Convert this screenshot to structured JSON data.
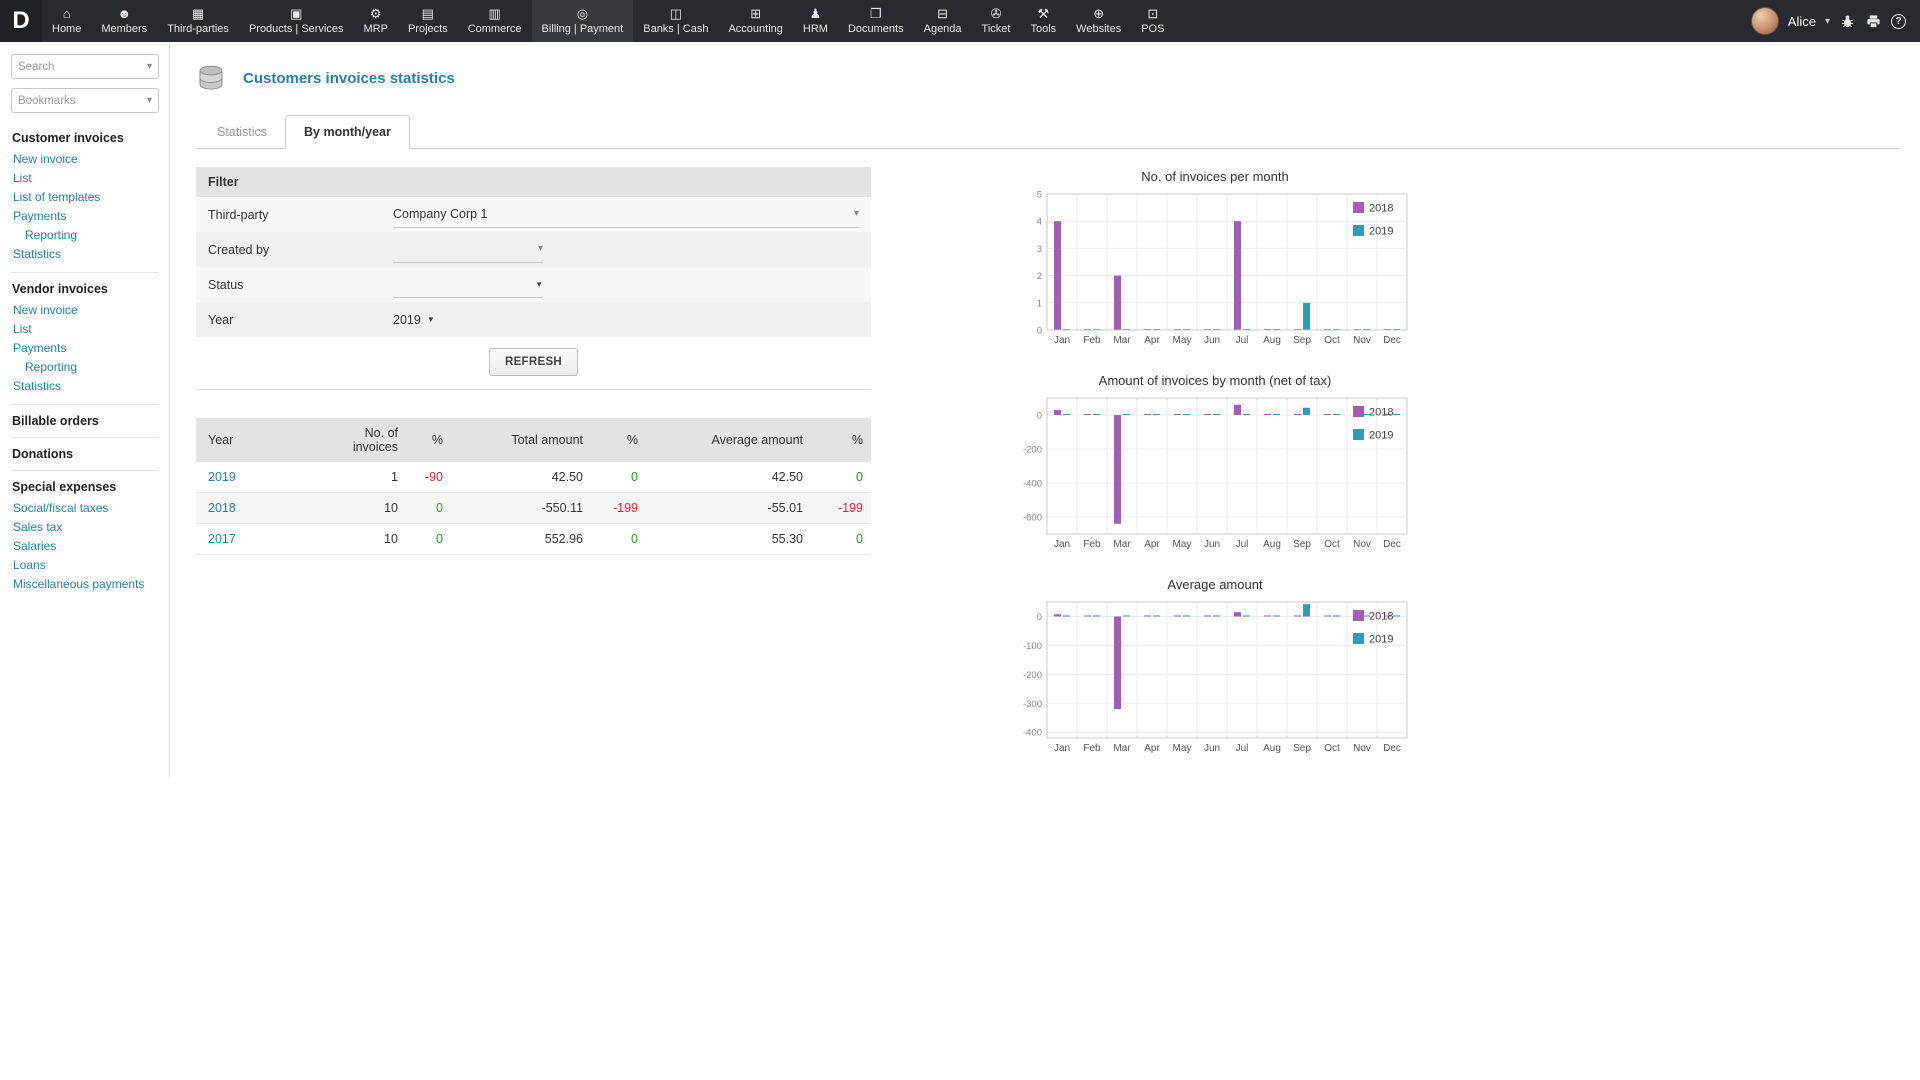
{
  "topbar": {
    "logo": "D",
    "items": [
      {
        "label": "Home",
        "icon": "home-icon",
        "active": false
      },
      {
        "label": "Members",
        "icon": "members-icon",
        "active": false
      },
      {
        "label": "Third-parties",
        "icon": "third-parties-icon",
        "active": false
      },
      {
        "label": "Products | Services",
        "icon": "products-icon",
        "active": false
      },
      {
        "label": "MRP",
        "icon": "mrp-icon",
        "active": false
      },
      {
        "label": "Projects",
        "icon": "projects-icon",
        "active": false
      },
      {
        "label": "Commerce",
        "icon": "commerce-icon",
        "active": false
      },
      {
        "label": "Billing | Payment",
        "icon": "billing-icon",
        "active": true
      },
      {
        "label": "Banks | Cash",
        "icon": "banks-icon",
        "active": false
      },
      {
        "label": "Accounting",
        "icon": "accounting-icon",
        "active": false
      },
      {
        "label": "HRM",
        "icon": "hrm-icon",
        "active": false
      },
      {
        "label": "Documents",
        "icon": "documents-icon",
        "active": false
      },
      {
        "label": "Agenda",
        "icon": "agenda-icon",
        "active": false
      },
      {
        "label": "Ticket",
        "icon": "ticket-icon",
        "active": false
      },
      {
        "label": "Tools",
        "icon": "tools-icon",
        "active": false
      },
      {
        "label": "Websites",
        "icon": "websites-icon",
        "active": false
      },
      {
        "label": "POS",
        "icon": "pos-icon",
        "active": false
      }
    ],
    "user": {
      "name": "Alice"
    }
  },
  "sidebar": {
    "search_placeholder": "Search",
    "bookmarks_placeholder": "Bookmarks",
    "sections": [
      {
        "title": "Customer invoices",
        "items": [
          {
            "label": "New invoice",
            "indent": false
          },
          {
            "label": "List",
            "indent": false
          },
          {
            "label": "List of templates",
            "indent": false
          },
          {
            "label": "Payments",
            "indent": false
          },
          {
            "label": "Reporting",
            "indent": true
          },
          {
            "label": "Statistics",
            "indent": false
          }
        ]
      },
      {
        "title": "Vendor invoices",
        "items": [
          {
            "label": "New invoice",
            "indent": false
          },
          {
            "label": "List",
            "indent": false
          },
          {
            "label": "Payments",
            "indent": false
          },
          {
            "label": "Reporting",
            "indent": true
          },
          {
            "label": "Statistics",
            "indent": false
          }
        ]
      },
      {
        "title": "Billable orders",
        "items": []
      },
      {
        "title": "Donations",
        "items": []
      },
      {
        "title": "Special expenses",
        "items": [
          {
            "label": "Social/fiscal taxes",
            "indent": false
          },
          {
            "label": "Sales tax",
            "indent": false
          },
          {
            "label": "Salaries",
            "indent": false
          },
          {
            "label": "Loans",
            "indent": false
          },
          {
            "label": "Miscellaneous payments",
            "indent": false
          }
        ]
      }
    ]
  },
  "page": {
    "title": "Customers invoices statistics",
    "tabs": [
      {
        "label": "Statistics",
        "active": false
      },
      {
        "label": "By month/year",
        "active": true
      }
    ]
  },
  "filter": {
    "title": "Filter",
    "rows": [
      {
        "label": "Third-party",
        "value": "Company Corp 1"
      },
      {
        "label": "Created by",
        "value": ""
      },
      {
        "label": "Status",
        "value": ""
      },
      {
        "label": "Year",
        "value": "2019"
      }
    ],
    "refresh_label": "REFRESH"
  },
  "results": {
    "headers": [
      "Year",
      "No. of invoices",
      "%",
      "Total amount",
      "%",
      "Average amount",
      "%"
    ],
    "rows": [
      [
        "2019",
        "1",
        "-90",
        "42.50",
        "0",
        "42.50",
        "0"
      ],
      [
        "2018",
        "10",
        "0",
        "-550.11",
        "-199",
        "-55.01",
        "-199"
      ],
      [
        "2017",
        "10",
        "0",
        "552.96",
        "0",
        "55.30",
        "0"
      ]
    ]
  },
  "colors": {
    "link": "#2581a5",
    "positive": "#23a123",
    "negative": "#d22d2d",
    "series_2018": "#a05eb5",
    "series_2019": "#2d9db4",
    "topbar": "#272a2f"
  },
  "chart_data": [
    {
      "type": "bar",
      "title": "No. of invoices per month",
      "categories": [
        "Jan",
        "Feb",
        "Mar",
        "Apr",
        "May",
        "Jun",
        "Jul",
        "Aug",
        "Sep",
        "Oct",
        "Nov",
        "Dec"
      ],
      "series": [
        {
          "name": "2018",
          "color": "#a05eb5",
          "values": [
            4,
            0,
            2,
            0,
            0,
            0,
            4,
            0,
            0,
            0,
            0,
            0
          ]
        },
        {
          "name": "2019",
          "color": "#2d9db4",
          "values": [
            0,
            0,
            0,
            0,
            0,
            0,
            0,
            0,
            1,
            0,
            0,
            0
          ]
        }
      ],
      "ylim": [
        0,
        5
      ],
      "yticks": [
        0,
        1,
        2,
        3,
        4,
        5
      ],
      "grid": true,
      "legend_position": "top-right"
    },
    {
      "type": "bar",
      "title": "Amount of invoices by month (net of tax)",
      "categories": [
        "Jan",
        "Feb",
        "Mar",
        "Apr",
        "May",
        "Jun",
        "Jul",
        "Aug",
        "Sep",
        "Oct",
        "Nov",
        "Dec"
      ],
      "series": [
        {
          "name": "2018",
          "color": "#a05eb5",
          "values": [
            30,
            0,
            -640,
            0,
            0,
            0,
            60,
            0,
            0,
            0,
            0,
            0
          ]
        },
        {
          "name": "2019",
          "color": "#2d9db4",
          "values": [
            0,
            0,
            0,
            0,
            0,
            0,
            0,
            0,
            42.5,
            0,
            0,
            0
          ]
        }
      ],
      "ylim": [
        -700,
        100
      ],
      "yticks": [
        0,
        -200,
        -400,
        -600
      ],
      "grid": true,
      "legend_position": "top-right"
    },
    {
      "type": "bar",
      "title": "Average amount",
      "categories": [
        "Jan",
        "Feb",
        "Mar",
        "Apr",
        "May",
        "Jun",
        "Jul",
        "Aug",
        "Sep",
        "Oct",
        "Nov",
        "Dec"
      ],
      "series": [
        {
          "name": "2018",
          "color": "#a05eb5",
          "values": [
            7.5,
            0,
            -320,
            0,
            0,
            0,
            15,
            0,
            0,
            0,
            0,
            0
          ]
        },
        {
          "name": "2019",
          "color": "#2d9db4",
          "values": [
            0,
            0,
            0,
            0,
            0,
            0,
            0,
            0,
            42.5,
            0,
            0,
            0
          ]
        }
      ],
      "ylim": [
        -420,
        50
      ],
      "yticks": [
        0,
        -100,
        -200,
        -300,
        -400
      ],
      "grid": true,
      "legend_position": "top-right"
    }
  ]
}
